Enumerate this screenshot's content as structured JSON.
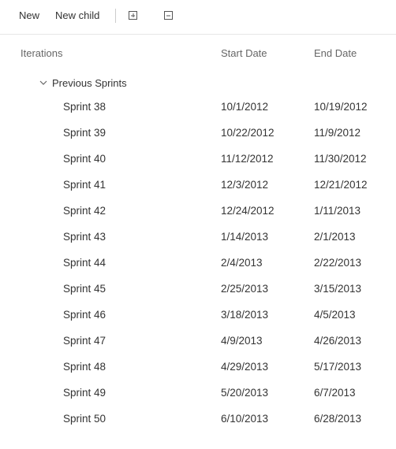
{
  "toolbar": {
    "new_label": "New",
    "new_child_label": "New child"
  },
  "headers": {
    "iterations": "Iterations",
    "start_date": "Start Date",
    "end_date": "End Date"
  },
  "group": {
    "label": "Previous Sprints",
    "expanded": true
  },
  "sprints": [
    {
      "name": "Sprint 38",
      "start": "10/1/2012",
      "end": "10/19/2012"
    },
    {
      "name": "Sprint 39",
      "start": "10/22/2012",
      "end": "11/9/2012"
    },
    {
      "name": "Sprint 40",
      "start": "11/12/2012",
      "end": "11/30/2012"
    },
    {
      "name": "Sprint 41",
      "start": "12/3/2012",
      "end": "12/21/2012"
    },
    {
      "name": "Sprint 42",
      "start": "12/24/2012",
      "end": "1/11/2013"
    },
    {
      "name": "Sprint 43",
      "start": "1/14/2013",
      "end": "2/1/2013"
    },
    {
      "name": "Sprint 44",
      "start": "2/4/2013",
      "end": "2/22/2013"
    },
    {
      "name": "Sprint 45",
      "start": "2/25/2013",
      "end": "3/15/2013"
    },
    {
      "name": "Sprint 46",
      "start": "3/18/2013",
      "end": "4/5/2013"
    },
    {
      "name": "Sprint 47",
      "start": "4/9/2013",
      "end": "4/26/2013"
    },
    {
      "name": "Sprint 48",
      "start": "4/29/2013",
      "end": "5/17/2013"
    },
    {
      "name": "Sprint 49",
      "start": "5/20/2013",
      "end": "6/7/2013"
    },
    {
      "name": "Sprint 50",
      "start": "6/10/2013",
      "end": "6/28/2013"
    }
  ]
}
